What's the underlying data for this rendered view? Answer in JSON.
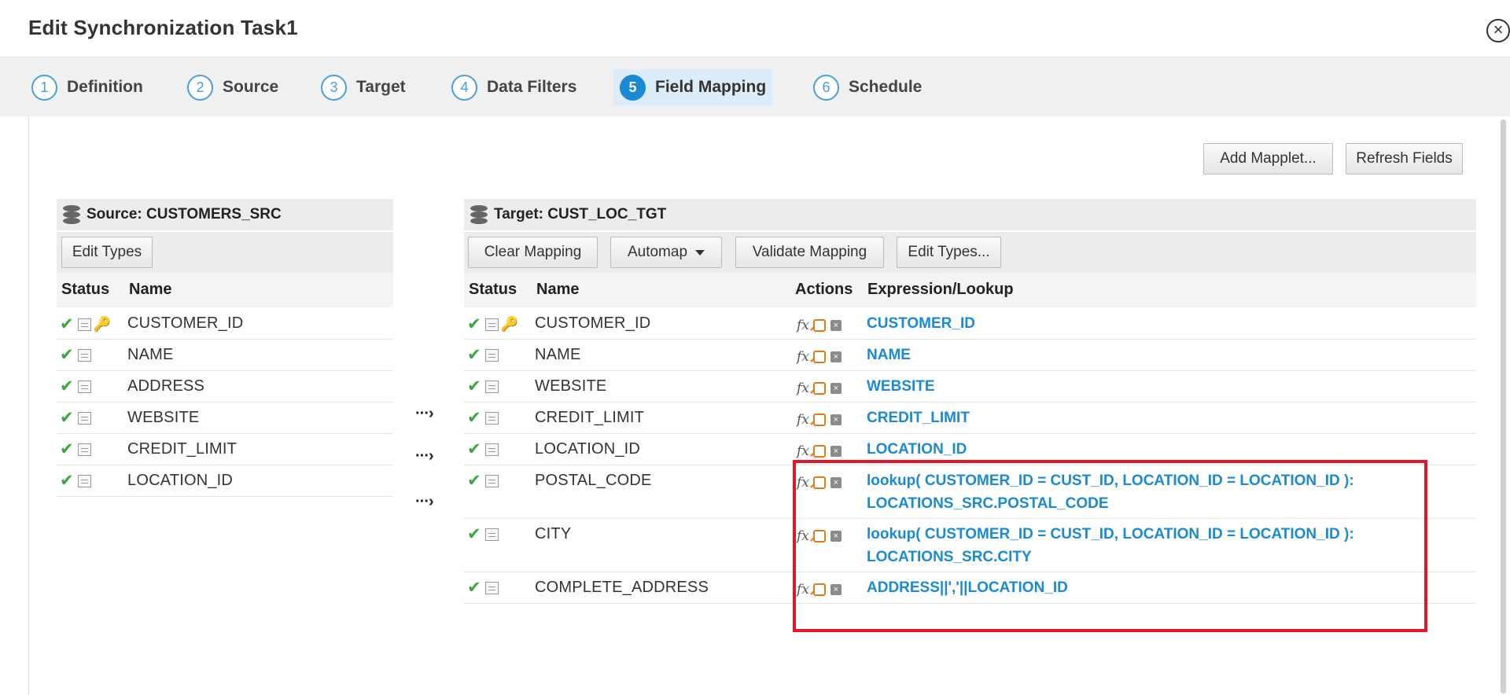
{
  "window": {
    "title": "Edit Synchronization Task1",
    "close_glyph": "×"
  },
  "steps": [
    {
      "num": "1",
      "label": "Definition"
    },
    {
      "num": "2",
      "label": "Source"
    },
    {
      "num": "3",
      "label": "Target"
    },
    {
      "num": "4",
      "label": "Data Filters"
    },
    {
      "num": "5",
      "label": "Field Mapping"
    },
    {
      "num": "6",
      "label": "Schedule"
    }
  ],
  "top_buttons": {
    "add_mapplet": "Add Mapplet...",
    "refresh_fields": "Refresh Fields"
  },
  "source": {
    "header": "Source: CUSTOMERS_SRC",
    "edit_types": "Edit Types",
    "col_status": "Status",
    "col_name": "Name",
    "fields": [
      "CUSTOMER_ID",
      "NAME",
      "ADDRESS",
      "WEBSITE",
      "CREDIT_LIMIT",
      "LOCATION_ID"
    ]
  },
  "target": {
    "header": "Target: CUST_LOC_TGT",
    "clear_mapping": "Clear Mapping",
    "automap": "Automap",
    "validate_mapping": "Validate Mapping",
    "edit_types": "Edit Types...",
    "col_status": "Status",
    "col_name": "Name",
    "col_actions": "Actions",
    "col_expression": "Expression/Lookup",
    "fields": [
      {
        "name": "CUSTOMER_ID",
        "expr1": "CUSTOMER_ID",
        "expr2": ""
      },
      {
        "name": "NAME",
        "expr1": "NAME",
        "expr2": ""
      },
      {
        "name": "WEBSITE",
        "expr1": "WEBSITE",
        "expr2": ""
      },
      {
        "name": "CREDIT_LIMIT",
        "expr1": "CREDIT_LIMIT",
        "expr2": ""
      },
      {
        "name": "LOCATION_ID",
        "expr1": "LOCATION_ID",
        "expr2": ""
      },
      {
        "name": "POSTAL_CODE",
        "expr1": "lookup( CUSTOMER_ID = CUST_ID, LOCATION_ID = LOCATION_ID ):",
        "expr2": "LOCATIONS_SRC.POSTAL_CODE"
      },
      {
        "name": "CITY",
        "expr1": "lookup( CUSTOMER_ID = CUST_ID, LOCATION_ID = LOCATION_ID ):",
        "expr2": "LOCATIONS_SRC.CITY"
      },
      {
        "name": "COMPLETE_ADDRESS",
        "expr1": "ADDRESS||','||LOCATION_ID",
        "expr2": ""
      }
    ]
  },
  "icons": {
    "check": "✔",
    "key": "🔑",
    "fx": "fx",
    "remove": "×",
    "arrow": "···›"
  },
  "colors": {
    "accent": "#1a8ad4",
    "status_ok": "#3aa640",
    "highlight": "#e3152b"
  }
}
